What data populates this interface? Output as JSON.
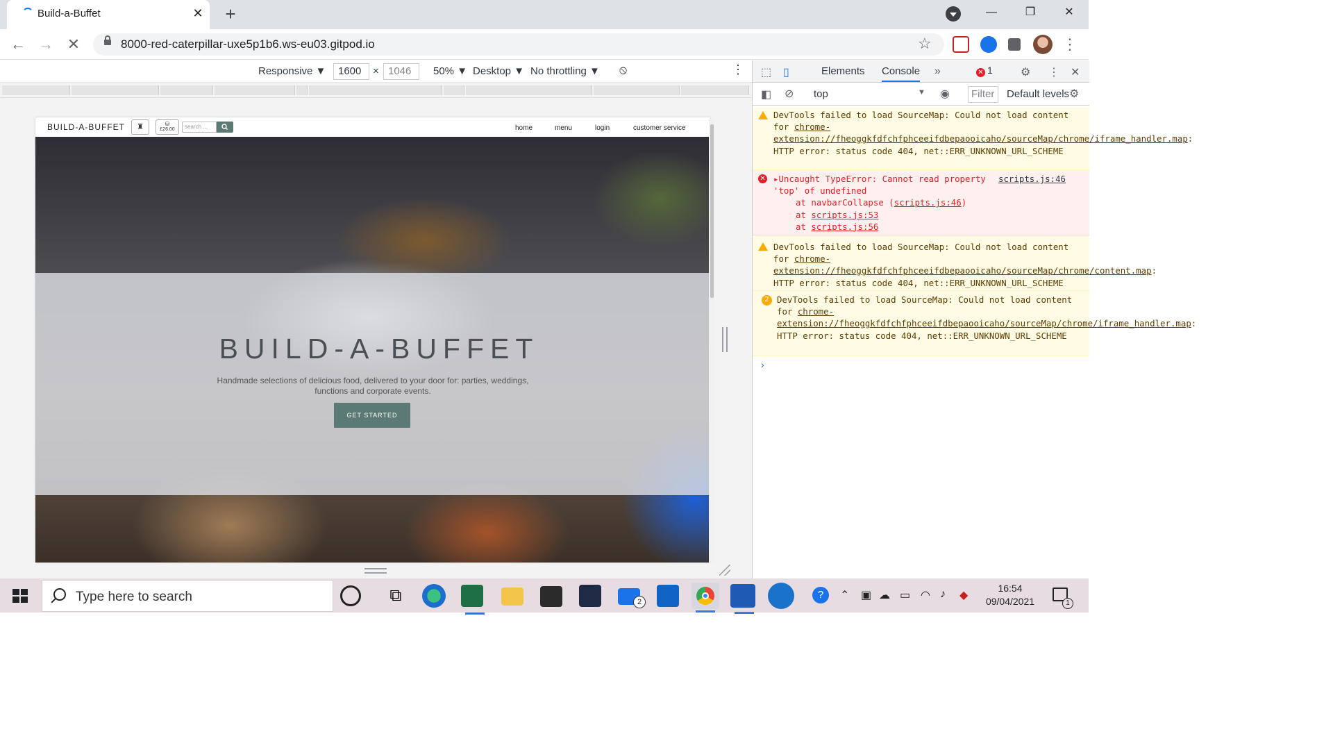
{
  "browser": {
    "tab_title": "Build-a-Buffet",
    "url": "8000-red-caterpillar-uxe5p1b6.ws-eu03.gitpod.io"
  },
  "device_toolbar": {
    "mode": "Responsive",
    "width": "1600",
    "height": "1046",
    "zoom": "50%",
    "device_type": "Desktop",
    "throttling": "No throttling"
  },
  "site": {
    "brand": "BUILD-A-BUFFET",
    "cart_total": "£26.00",
    "search_placeholder": "search ...",
    "nav": [
      "home",
      "menu",
      "login",
      "customer service"
    ],
    "hero_title": "BUILD-A-BUFFET",
    "hero_text": "Handmade selections of delicious food, delivered to your door for: parties, weddings, functions and corporate events.",
    "cta": "GET STARTED"
  },
  "devtools": {
    "tabs": [
      "Elements",
      "Console"
    ],
    "active_tab": "Console",
    "error_count": "1",
    "context": "top",
    "filter_placeholder": "Filter",
    "levels": "Default levels",
    "messages": [
      {
        "level": "warning",
        "prefix": "DevTools failed to load SourceMap: Could not load content for ",
        "link": "chrome-extension://fheoggkfdfchfphceeifdbepaooicaho/sourceMap/chrome/iframe_handler.map",
        "suffix": ": HTTP error: status code 404, net::ERR_UNKNOWN_URL_SCHEME"
      },
      {
        "level": "error",
        "text": "Uncaught TypeError: Cannot read property 'top' of undefined",
        "source": "scripts.js:46",
        "stack": [
          {
            "fn": "at navbarCollapse (",
            "loc": "scripts.js:46",
            "end": ")"
          },
          {
            "fn": "at ",
            "loc": "scripts.js:53",
            "end": ""
          },
          {
            "fn": "at ",
            "loc": "scripts.js:56",
            "end": ""
          }
        ]
      },
      {
        "level": "warning",
        "prefix": "DevTools failed to load SourceMap: Could not load content for ",
        "link": "chrome-extension://fheoggkfdfchfphceeifdbepaooicaho/sourceMap/chrome/content.map",
        "suffix": ": HTTP error: status code 404, net::ERR_UNKNOWN_URL_SCHEME"
      },
      {
        "level": "warning",
        "count": "2",
        "prefix": "DevTools failed to load SourceMap: Could not load content for ",
        "link": "chrome-extension://fheoggkfdfchfphceeifdbepaooicaho/sourceMap/chrome/iframe_handler.map",
        "suffix": ": HTTP error: status code 404, net::ERR_UNKNOWN_URL_SCHEME"
      }
    ]
  },
  "taskbar": {
    "search_placeholder": "Type here to search",
    "mail_badge": "2",
    "time": "16:54",
    "date": "09/04/2021",
    "notification_count": "1"
  },
  "colors": {
    "accent": "#5b7a73",
    "chrome_blue": "#1a73e8",
    "error_red": "#e41e26",
    "warning_yellow": "#f9ab00"
  }
}
